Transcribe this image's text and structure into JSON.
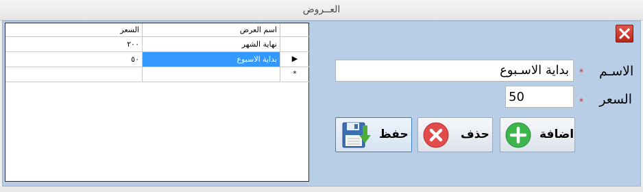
{
  "window": {
    "title": "العــروض"
  },
  "grid": {
    "columns": [
      "اسم العرض",
      "السعر"
    ],
    "rows": [
      {
        "name": "نهاية الشهر",
        "price": "٢٠٠",
        "selected": false,
        "indicator": ""
      },
      {
        "name": "بداية الاسبوع",
        "price": "٥٠",
        "selected": true,
        "indicator": "▶"
      },
      {
        "name": "",
        "price": "",
        "selected": false,
        "indicator": "*"
      }
    ]
  },
  "form": {
    "name_label": "الاسـم",
    "name_required": "*",
    "name_value": "بداية الاسـبوع",
    "price_label": "السعر",
    "price_required": "*",
    "price_value": "50"
  },
  "buttons": {
    "add_label": "اضافة",
    "delete_label": "حذف",
    "save_label": "حفظ"
  },
  "colors": {
    "panel": "#b8cde6",
    "selection": "#3399ff",
    "close": "#c8342a",
    "add": "#3cb54a",
    "delete": "#e24b4b",
    "save_arrow": "#4caf35"
  },
  "icons": {
    "close": "close-icon",
    "add": "plus-circle-icon",
    "delete": "x-circle-icon",
    "save": "floppy-disk-icon"
  }
}
